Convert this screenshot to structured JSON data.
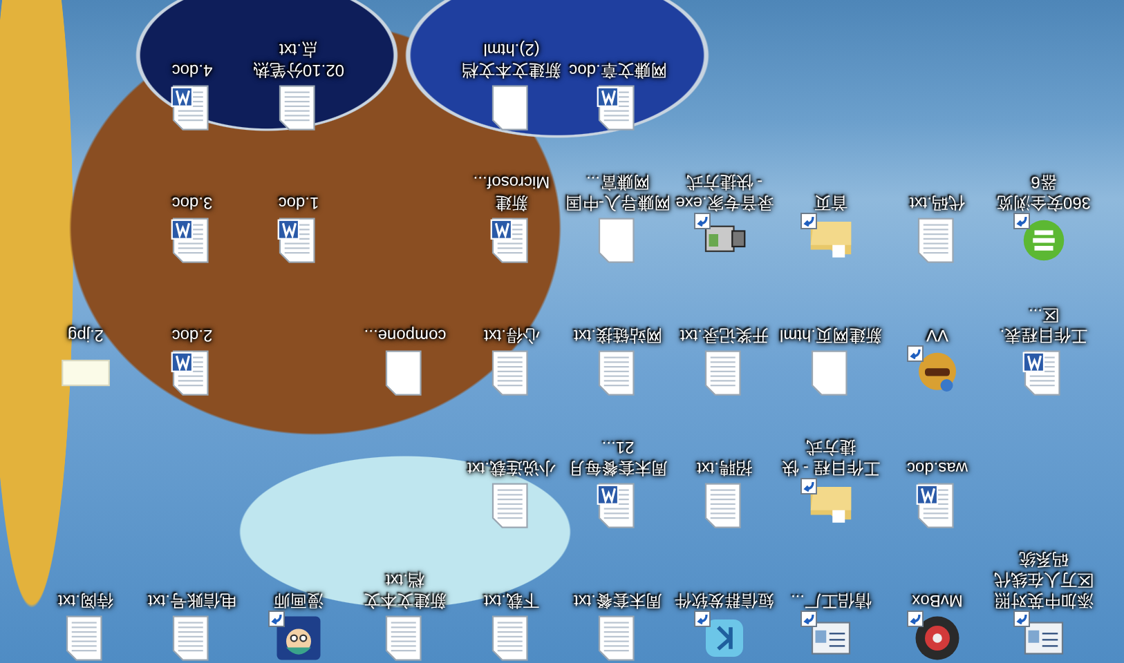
{
  "desktop": {
    "columns": [
      {
        "icons": [
          {
            "label": "添加中英对照区万人在线代码系统",
            "kind": "app",
            "shortcut": true
          },
          {
            "label": "工作日程表.区...",
            "kind": "word",
            "shortcut": false
          },
          {
            "label": "360安全浏览器6",
            "kind": "browser",
            "shortcut": true
          }
        ]
      },
      {
        "icons": [
          {
            "label": "MvBox",
            "kind": "disc",
            "shortcut": true
          },
          {
            "label": "was.doc",
            "kind": "word",
            "shortcut": false
          },
          {
            "label": "VV",
            "kind": "mascot",
            "shortcut": true
          },
          {
            "label": "代码.txt",
            "kind": "text",
            "shortcut": false
          }
        ]
      },
      {
        "icons": [
          {
            "label": "情侣工厂...",
            "kind": "app",
            "shortcut": true
          },
          {
            "label": "工作日程 - 快捷方式",
            "kind": "folder",
            "shortcut": true
          },
          {
            "label": "新建网页.html",
            "kind": "blank",
            "shortcut": false
          },
          {
            "label": "首页",
            "kind": "folder",
            "shortcut": true
          }
        ]
      },
      {
        "icons": [
          {
            "label": "短信群发软件",
            "kind": "kapp",
            "shortcut": true
          },
          {
            "label": "招聘.txt",
            "kind": "text",
            "shortcut": false
          },
          {
            "label": "开奖记录.txt",
            "kind": "text",
            "shortcut": false
          },
          {
            "label": "录音专家.exe - 快捷方式",
            "kind": "camera",
            "shortcut": true
          }
        ]
      },
      {
        "icons": [
          {
            "label": "周末套餐.txt",
            "kind": "text",
            "shortcut": false
          },
          {
            "label": "周末套餐每月21...",
            "kind": "word",
            "shortcut": false
          },
          {
            "label": "网站链接.txt",
            "kind": "text",
            "shortcut": false
          },
          {
            "label": "网赚导入-中国网赚富...",
            "kind": "blank",
            "shortcut": false
          },
          {
            "label": "网赚文章.doc",
            "kind": "word",
            "shortcut": false
          }
        ]
      },
      {
        "icons": [
          {
            "label": "下载.txt",
            "kind": "text",
            "shortcut": false
          },
          {
            "label": "小说连载.txt",
            "kind": "text",
            "shortcut": false
          },
          {
            "label": "心得.txt",
            "kind": "text",
            "shortcut": false
          },
          {
            "label": "新建 Microsof...",
            "kind": "word",
            "shortcut": false
          },
          {
            "label": "新建文本文档 (2).html",
            "kind": "blank",
            "shortcut": false
          }
        ]
      },
      {
        "icons": [
          {
            "label": "新建文本文档.txt",
            "kind": "text",
            "shortcut": false
          },
          {
            "label": "compone...",
            "kind": "blank",
            "shortcut": false
          }
        ]
      },
      {
        "icons": [
          {
            "label": "漫画师",
            "kind": "cartoon",
            "shortcut": true
          },
          {
            "label": "1.doc",
            "kind": "word",
            "shortcut": false
          },
          {
            "label": "02.10分笔热点.txt",
            "kind": "text",
            "shortcut": false
          }
        ]
      },
      {
        "icons": [
          {
            "label": "电信账号.txt",
            "kind": "text",
            "shortcut": false
          },
          {
            "label": "2.doc",
            "kind": "word",
            "shortcut": false
          },
          {
            "label": "3.doc",
            "kind": "word",
            "shortcut": false
          },
          {
            "label": "4.doc",
            "kind": "word",
            "shortcut": false
          }
        ]
      },
      {
        "icons": [
          {
            "label": "待阅.txt",
            "kind": "text",
            "shortcut": false
          },
          {
            "label": "2.jpg",
            "kind": "image",
            "shortcut": false
          }
        ]
      }
    ]
  }
}
